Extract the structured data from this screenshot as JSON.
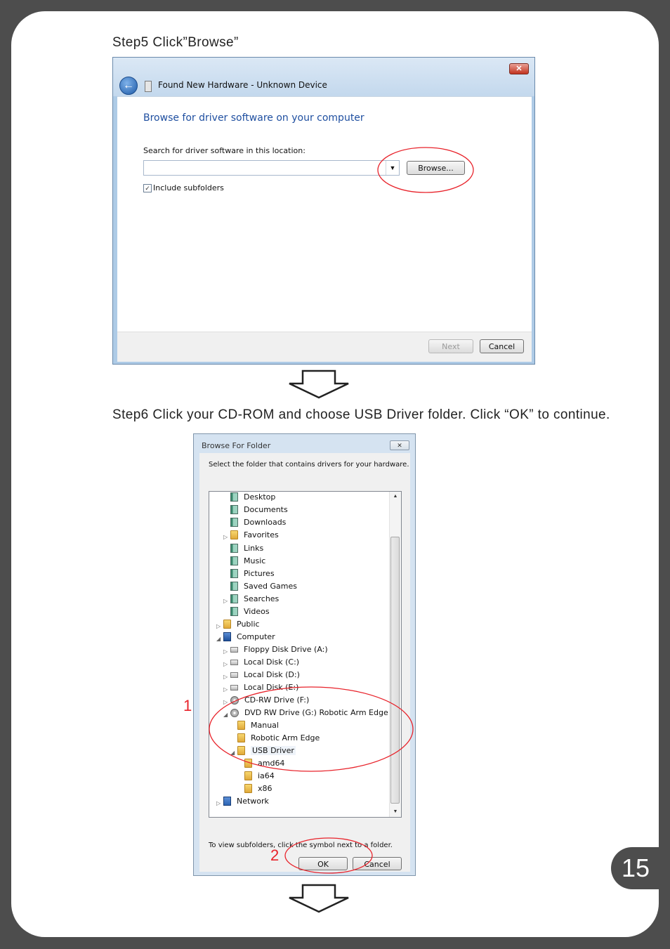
{
  "step5": {
    "text": "Step5  Click”Browse”"
  },
  "window1": {
    "title": "Found New Hardware - Unknown Device",
    "close": "✕",
    "heading": "Browse for driver software on your computer",
    "search_label": "Search for driver software in this location:",
    "path_value": "",
    "browse_label": "Browse...",
    "include_subfolders": "Include subfolders",
    "next_label": "Next",
    "cancel_label": "Cancel"
  },
  "step6": {
    "text": "Step6  Click your CD-ROM and choose USB Driver folder.  Click “OK” to continue."
  },
  "window2": {
    "title": "Browse For Folder",
    "close": "✕",
    "instruction": "Select the folder that contains drivers for your hardware.",
    "tree": [
      {
        "label": "Desktop"
      },
      {
        "label": "Documents"
      },
      {
        "label": "Downloads"
      },
      {
        "label": "Favorites"
      },
      {
        "label": "Links"
      },
      {
        "label": "Music"
      },
      {
        "label": "Pictures"
      },
      {
        "label": "Saved Games"
      },
      {
        "label": "Searches"
      },
      {
        "label": "Videos"
      },
      {
        "label": "Public"
      },
      {
        "label": "Computer"
      },
      {
        "label": "Floppy Disk Drive (A:)"
      },
      {
        "label": "Local Disk (C:)"
      },
      {
        "label": "Local Disk (D:)"
      },
      {
        "label": "Local Disk (E:)"
      },
      {
        "label": "CD-RW Drive (F:)"
      },
      {
        "label": "DVD RW Drive (G:) Robotic Arm Edge"
      },
      {
        "label": "Manual"
      },
      {
        "label": "Robotic Arm Edge"
      },
      {
        "label": "USB Driver"
      },
      {
        "label": "amd64"
      },
      {
        "label": "ia64"
      },
      {
        "label": "x86"
      },
      {
        "label": "Network"
      }
    ],
    "hint": "To view subfolders, click the symbol next to a folder.",
    "ok_label": "OK",
    "cancel_label": "Cancel"
  },
  "annotations": {
    "one": "1",
    "two": "2"
  },
  "page_number": "15",
  "colors": {
    "highlight": "#e8222a",
    "frame": "#4d4d4d"
  }
}
